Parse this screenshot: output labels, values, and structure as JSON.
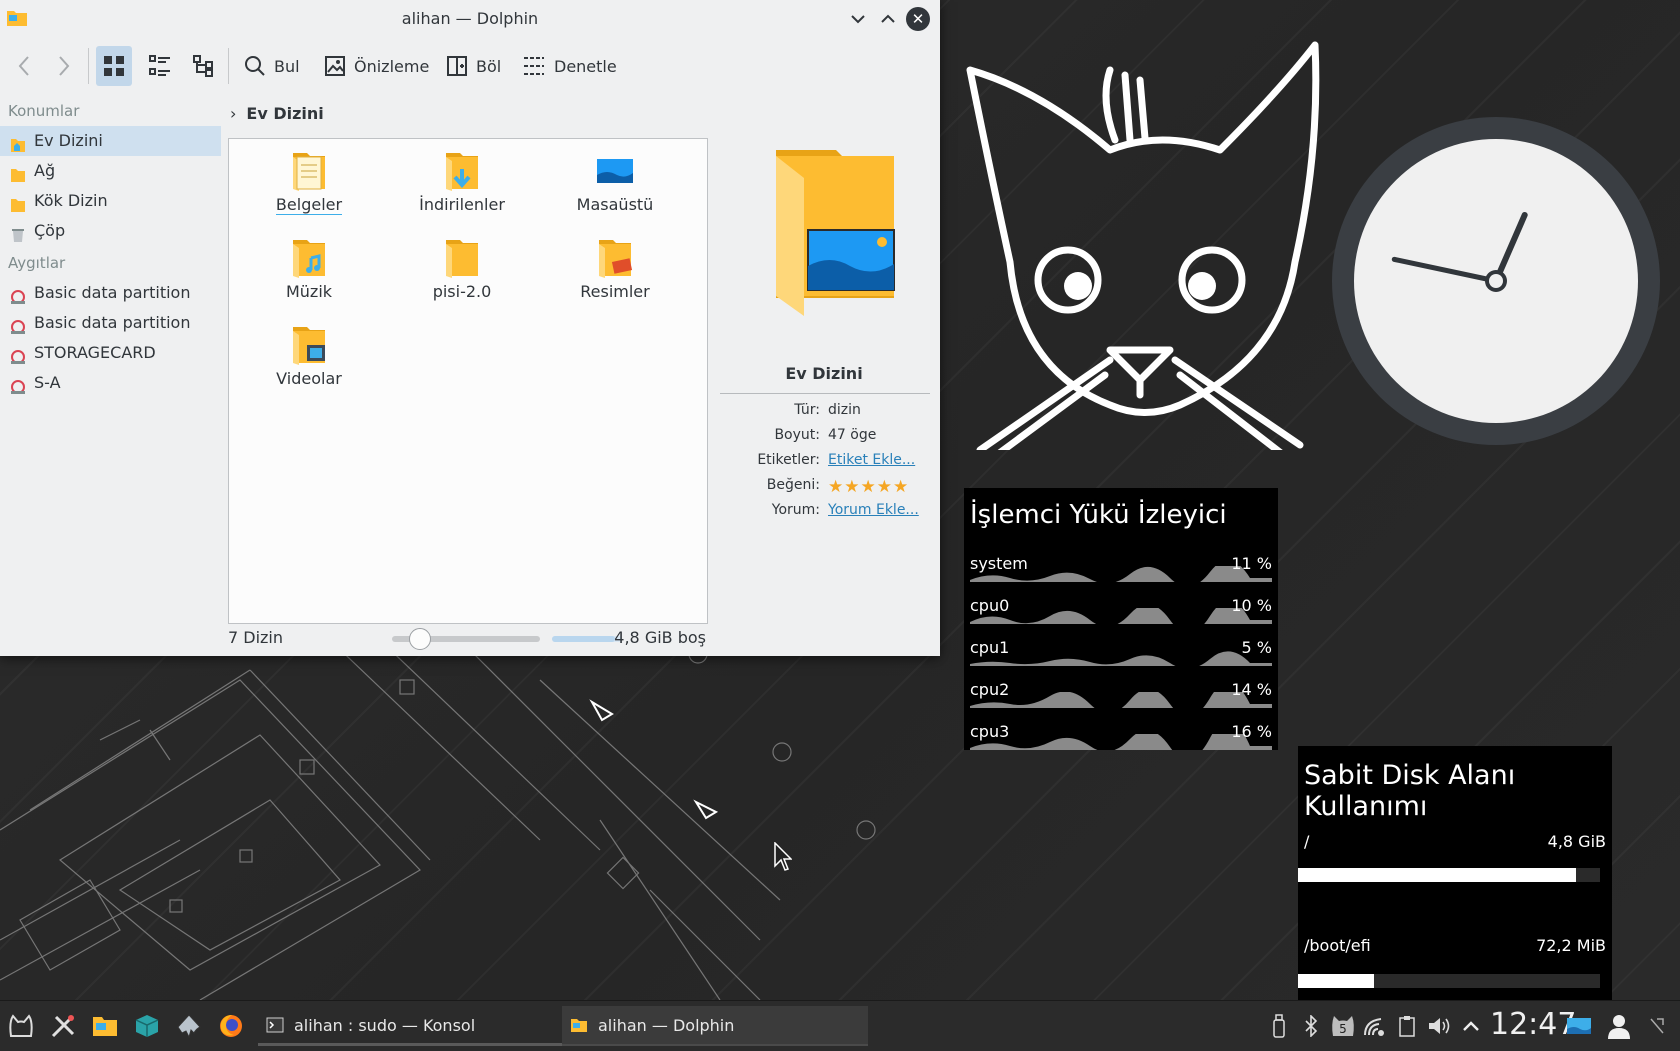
{
  "window": {
    "title": "alihan — Dolphin",
    "toolbar": {
      "find": "Bul",
      "preview": "Önizleme",
      "split": "Böl",
      "control": "Denetle"
    },
    "sidebar": {
      "places_header": "Konumlar",
      "places": [
        {
          "label": "Ev Dizini",
          "icon": "home-folder-icon",
          "selected": true
        },
        {
          "label": "Ağ",
          "icon": "network-folder-icon"
        },
        {
          "label": "Kök Dizin",
          "icon": "root-folder-icon"
        },
        {
          "label": "Çöp",
          "icon": "trash-icon"
        }
      ],
      "devices_header": "Aygıtlar",
      "devices": [
        {
          "label": "Basic data partition",
          "icon": "drive-icon"
        },
        {
          "label": "Basic data partition",
          "icon": "drive-icon"
        },
        {
          "label": "STORAGECARD",
          "icon": "drive-icon"
        },
        {
          "label": "S-A",
          "icon": "drive-icon"
        }
      ]
    },
    "breadcrumb": "Ev Dizini",
    "files": [
      {
        "label": "Belgeler",
        "icon": "documents-folder-icon"
      },
      {
        "label": "İndirilenler",
        "icon": "downloads-folder-icon"
      },
      {
        "label": "Masaüstü",
        "icon": "desktop-folder-icon"
      },
      {
        "label": "Müzik",
        "icon": "music-folder-icon"
      },
      {
        "label": "pisi-2.0",
        "icon": "folder-icon"
      },
      {
        "label": "Resimler",
        "icon": "pictures-folder-icon"
      },
      {
        "label": "Videolar",
        "icon": "videos-folder-icon"
      }
    ],
    "status": {
      "count": "7 Dizin",
      "free": "4,8 GiB boş",
      "zoom_level": 0.18,
      "used_fraction": 0.9
    },
    "info": {
      "name": "Ev Dizini",
      "type_label": "Tür:",
      "type_value": "dizin",
      "size_label": "Boyut:",
      "size_value": "47 öge",
      "tags_label": "Etiketler:",
      "tags_value": "Etiket Ekle...",
      "rating_label": "Beğeni:",
      "rating_value": 5,
      "comment_label": "Yorum:",
      "comment_value": "Yorum Ekle..."
    }
  },
  "cpu_widget": {
    "title": "İşlemci Yükü İzleyici",
    "rows": [
      {
        "name": "system",
        "percent": "11 %"
      },
      {
        "name": "cpu0",
        "percent": "10 %"
      },
      {
        "name": "cpu1",
        "percent": "5 %"
      },
      {
        "name": "cpu2",
        "percent": "14 %"
      },
      {
        "name": "cpu3",
        "percent": "16 %"
      }
    ]
  },
  "disk_widget": {
    "title": "Sabit Disk Alanı Kullanımı",
    "disks": [
      {
        "mount": "/",
        "size": "4,8 GiB",
        "used_fraction": 0.92
      },
      {
        "mount": "/boot/efi",
        "size": "72,2 MiB",
        "used_fraction": 0.25
      }
    ]
  },
  "clock_widget": {
    "hour": 12,
    "minute": 47
  },
  "taskbar": {
    "launchers": [
      "app-menu-icon",
      "settings-icon",
      "file-manager-icon",
      "package-manager-icon",
      "inkscape-icon",
      "firefox-icon"
    ],
    "tasks": [
      {
        "label": "alihan : sudo — Konsol",
        "icon": "terminal-icon",
        "active": false
      },
      {
        "label": "alihan — Dolphin",
        "icon": "folder-icon",
        "active": true
      }
    ],
    "tray_badge": "5",
    "time": "12:47"
  },
  "colors": {
    "accent": "#3daee9",
    "selection": "#cfe0ef",
    "folder": "#fdbc31",
    "widget_bg": "#000000"
  }
}
